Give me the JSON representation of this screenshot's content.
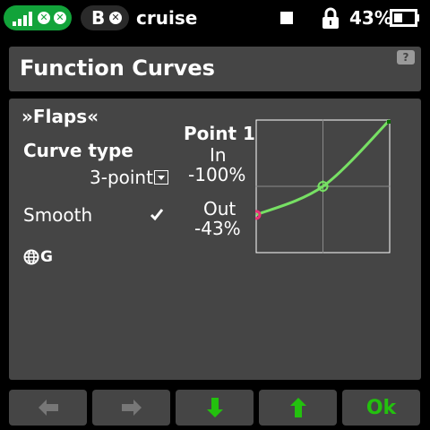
{
  "status_bar": {
    "module_label": "B",
    "model_name": "cruise",
    "battery_percent": "43%",
    "battery_level": 0.43
  },
  "title": "Function Curves",
  "panel": {
    "function_name": "»Flaps«",
    "curve_type_label": "Curve type",
    "curve_type_value": "3-point",
    "smooth_label": "Smooth",
    "smooth_checked": true,
    "global_label": "G",
    "point_title": "Point 1",
    "in_label": "In",
    "in_value": "-100%",
    "out_label": "Out",
    "out_value": "-43%"
  },
  "chart_data": {
    "type": "line",
    "x": [
      -100,
      0,
      100
    ],
    "y": [
      -43,
      0,
      100
    ],
    "xlim": [
      -100,
      100
    ],
    "ylim": [
      -100,
      100
    ],
    "selected_point_index": 0,
    "grid": "center crosshair"
  },
  "buttons": {
    "ok_label": "Ok"
  },
  "colors": {
    "status_green": "#12a33a",
    "panel_bg": "#454545",
    "curve_green": "#77e064",
    "selected_point": "#e83377",
    "button_green": "#23c10e"
  }
}
